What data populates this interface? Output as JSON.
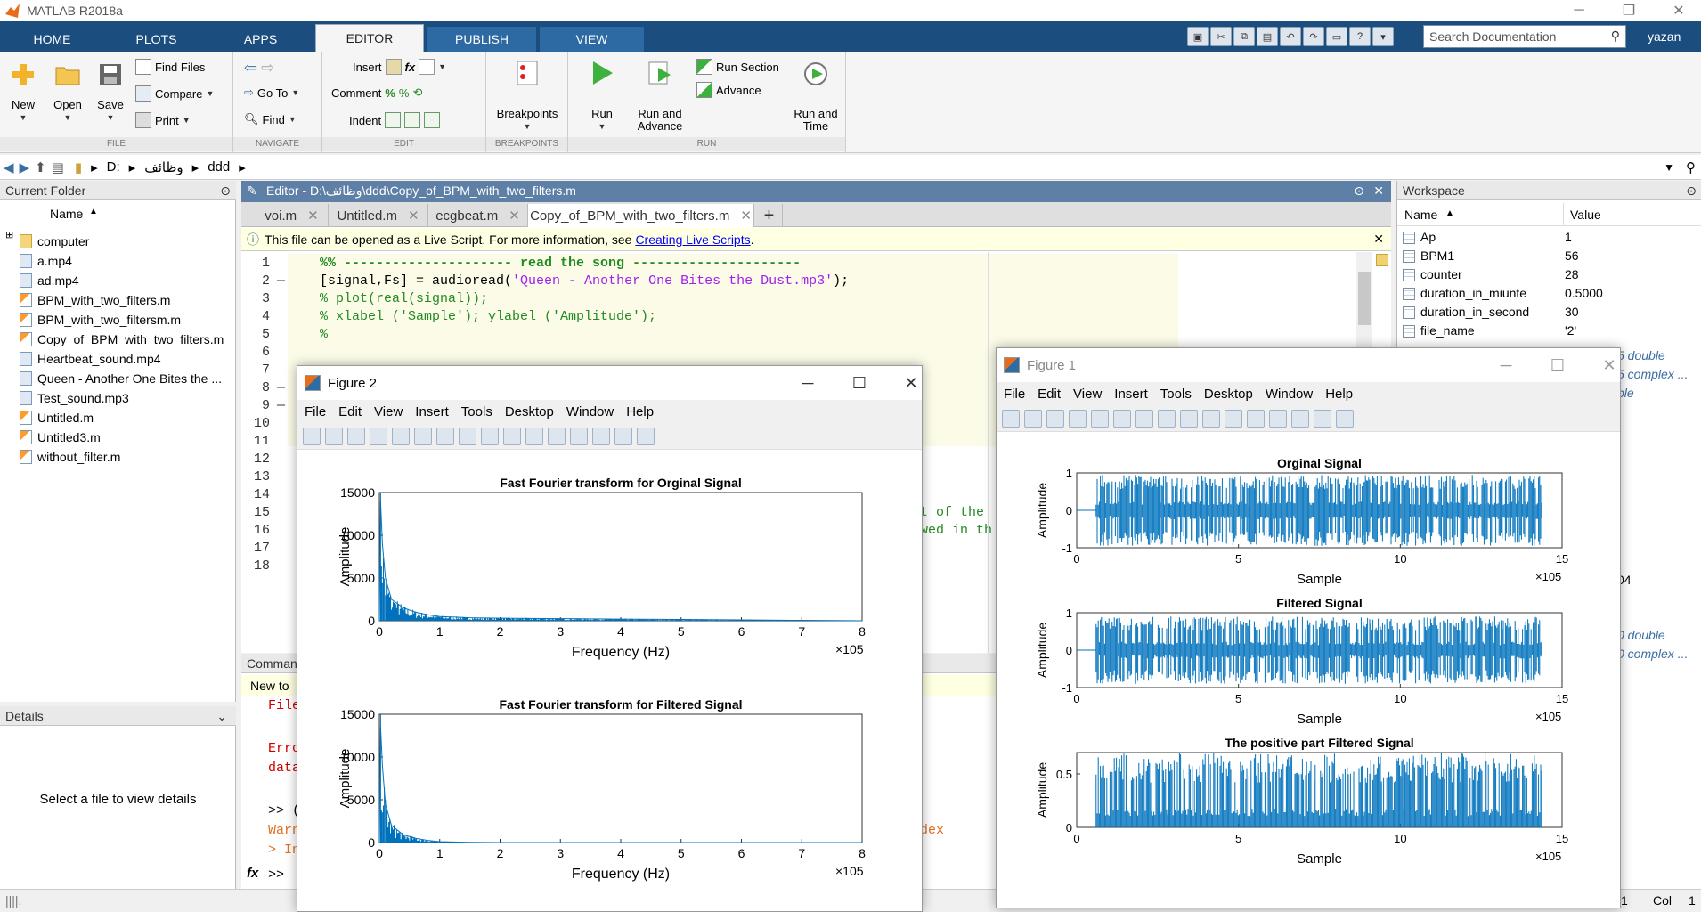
{
  "app": {
    "title": "MATLAB R2018a",
    "user": "yazan",
    "search_placeholder": "Search Documentation"
  },
  "ribbon_tabs": [
    "HOME",
    "PLOTS",
    "APPS",
    "EDITOR",
    "PUBLISH",
    "VIEW"
  ],
  "ribbon": {
    "file": {
      "name": "FILE",
      "new": "New",
      "open": "Open",
      "save": "Save",
      "find_files": "Find Files",
      "compare": "Compare",
      "print": "Print"
    },
    "navigate": {
      "name": "NAVIGATE",
      "goto": "Go To",
      "find": "Find"
    },
    "edit": {
      "name": "EDIT",
      "insert": "Insert",
      "comment": "Comment",
      "indent": "Indent"
    },
    "breakpoints": {
      "name": "BREAKPOINTS",
      "label": "Breakpoints"
    },
    "run": {
      "name": "RUN",
      "run": "Run",
      "run_and_advance": "Run and Advance",
      "run_section": "Run Section",
      "advance": "Advance",
      "run_and_time": "Run and Time"
    }
  },
  "address": {
    "drive": "D:",
    "folder1": "وظائف",
    "folder2": "ddd"
  },
  "current_folder": {
    "title": "Current Folder",
    "col_name": "Name",
    "items": [
      {
        "name": "computer",
        "kind": "folder"
      },
      {
        "name": "a.mp4",
        "kind": "media"
      },
      {
        "name": "ad.mp4",
        "kind": "media"
      },
      {
        "name": "BPM_with_two_filters.m",
        "kind": "m"
      },
      {
        "name": "BPM_with_two_filtersm.m",
        "kind": "m"
      },
      {
        "name": "Copy_of_BPM_with_two_filters.m",
        "kind": "m"
      },
      {
        "name": "Heartbeat_sound.mp4",
        "kind": "media"
      },
      {
        "name": "Queen - Another One Bites the ...",
        "kind": "media"
      },
      {
        "name": "Test_sound.mp3",
        "kind": "media"
      },
      {
        "name": "Untitled.m",
        "kind": "m"
      },
      {
        "name": "Untitled3.m",
        "kind": "m"
      },
      {
        "name": "without_filter.m",
        "kind": "m"
      }
    ]
  },
  "details": {
    "title": "Details",
    "message": "Select a file to view details"
  },
  "editor": {
    "header": "Editor - D:\\وظائف\\ddd\\Copy_of_BPM_with_two_filters.m",
    "tabs": [
      "voi.m",
      "Untitled.m",
      "ecgbeat.m",
      "Copy_of_BPM_with_two_filters.m"
    ],
    "info_text": "This file can be opened as a Live Script. For more information, see",
    "info_link": "Creating Live Scripts",
    "info_end": ".",
    "line_numbers": [
      "1",
      "2",
      "3",
      "4",
      "5",
      "6",
      "7",
      "8",
      "9",
      "10",
      "11",
      "12",
      "13",
      "14",
      "15",
      "16",
      "17",
      "18"
    ],
    "code": {
      "l1": "%% --------------------- read the song ---------------------",
      "l2a": "[signal,Fs] = audioread(",
      "l2b": "'Queen - Another One Bites the Dust.mp3'",
      "l2c": ");",
      "l3": "% plot(real(signal));",
      "l4": "% xlabel ('Sample'); ylabel ('Amplitude');",
      "l5": "%",
      "l15": "t of the",
      "l16": "wed in th"
    }
  },
  "command_window": {
    "title": "Comman",
    "new_to": "New to",
    "lines": [
      "File",
      "Erro",
      "data",
      ">> (",
      "Warn",
      "> In",
      ">>"
    ],
    "tail": "dex"
  },
  "workspace": {
    "title": "Workspace",
    "col_name": "Name",
    "col_value": "Value",
    "vars": [
      {
        "name": "Ap",
        "value": "1"
      },
      {
        "name": "BPM1",
        "value": "56"
      },
      {
        "name": "counter",
        "value": "28"
      },
      {
        "name": "duration_in_miunte",
        "value": "0.5000"
      },
      {
        "name": "duration_in_second",
        "value": "30"
      },
      {
        "name": "file_name",
        "value": "'2'"
      }
    ],
    "partial": [
      "5 double",
      "5 complex ...",
      "ble",
      "04",
      "0 double",
      "0 complex ..."
    ]
  },
  "status": {
    "ln": "1",
    "col_label": "Col",
    "col": "1"
  },
  "figure2": {
    "title": "Figure 2",
    "menus": [
      "File",
      "Edit",
      "View",
      "Insert",
      "Tools",
      "Desktop",
      "Window",
      "Help"
    ]
  },
  "figure1": {
    "title": "Figure 1",
    "menus": [
      "File",
      "Edit",
      "View",
      "Insert",
      "Tools",
      "Desktop",
      "Window",
      "Help"
    ]
  },
  "chart_data": [
    {
      "type": "line",
      "title": "Fast Fourier transform for Orginal Signal",
      "xlabel": "Frequency (Hz)",
      "ylabel": "Amplitude",
      "xlim": [
        0,
        800000
      ],
      "ylim": [
        0,
        15000
      ],
      "xticks": [
        "0",
        "1",
        "2",
        "3",
        "4",
        "5",
        "6",
        "7",
        "8"
      ],
      "yticks": [
        "0",
        "5000",
        "10000",
        "15000"
      ],
      "x_exponent": "×10^5",
      "x": [
        0,
        2000,
        5000,
        10000,
        20000,
        40000,
        60000,
        80000,
        100000,
        150000,
        200000,
        300000,
        400000,
        500000,
        600000,
        700000,
        800000
      ],
      "y": [
        0,
        14000,
        9000,
        5000,
        2500,
        1500,
        1000,
        700,
        500,
        350,
        300,
        250,
        200,
        150,
        100,
        50,
        0
      ]
    },
    {
      "type": "line",
      "title": "Fast Fourier transform for Filtered Signal",
      "xlabel": "Frequency (Hz)",
      "ylabel": "Amplitude",
      "xlim": [
        0,
        800000
      ],
      "ylim": [
        0,
        15000
      ],
      "xticks": [
        "0",
        "1",
        "2",
        "3",
        "4",
        "5",
        "6",
        "7",
        "8"
      ],
      "yticks": [
        "0",
        "5000",
        "10000",
        "15000"
      ],
      "x_exponent": "×10^5",
      "x": [
        0,
        2000,
        5000,
        10000,
        20000,
        40000,
        60000,
        80000,
        100000,
        150000,
        200000,
        800000
      ],
      "y": [
        0,
        13500,
        9000,
        4500,
        2000,
        900,
        500,
        250,
        100,
        30,
        0,
        0
      ]
    },
    {
      "type": "line",
      "title": "Orginal Signal",
      "xlabel": "Sample",
      "ylabel": "Amplitude",
      "xlim": [
        0,
        1500000
      ],
      "ylim": [
        -1,
        1
      ],
      "xticks": [
        "0",
        "5",
        "10",
        "15"
      ],
      "yticks": [
        "-1",
        "0",
        "1"
      ],
      "x_exponent": "×10^5",
      "sample_range": [
        60000,
        1440000
      ],
      "amplitude_envelope": 0.95
    },
    {
      "type": "line",
      "title": "Filtered Signal",
      "xlabel": "Sample",
      "ylabel": "Amplitude",
      "xlim": [
        0,
        1500000
      ],
      "ylim": [
        -1,
        1
      ],
      "xticks": [
        "0",
        "5",
        "10",
        "15"
      ],
      "yticks": [
        "-1",
        "0",
        "1"
      ],
      "x_exponent": "×10^5",
      "sample_range": [
        60000,
        1440000
      ],
      "amplitude_envelope": 0.9
    },
    {
      "type": "line",
      "title": "The positive part Filtered Signal",
      "xlabel": "Sample",
      "ylabel": "Amplitude",
      "xlim": [
        0,
        1500000
      ],
      "ylim": [
        0,
        0.7
      ],
      "xticks": [
        "0",
        "5",
        "10",
        "15"
      ],
      "yticks": [
        "0",
        "0.5"
      ],
      "x_exponent": "×10^5",
      "sample_range": [
        60000,
        1440000
      ],
      "amplitude_envelope": 0.7
    }
  ],
  "colors": {
    "accent": "#1b4d7e",
    "plot_line": "#0072bd",
    "editor_header": "#5e7fa6",
    "comment": "#228b22",
    "string": "#a020f0"
  }
}
